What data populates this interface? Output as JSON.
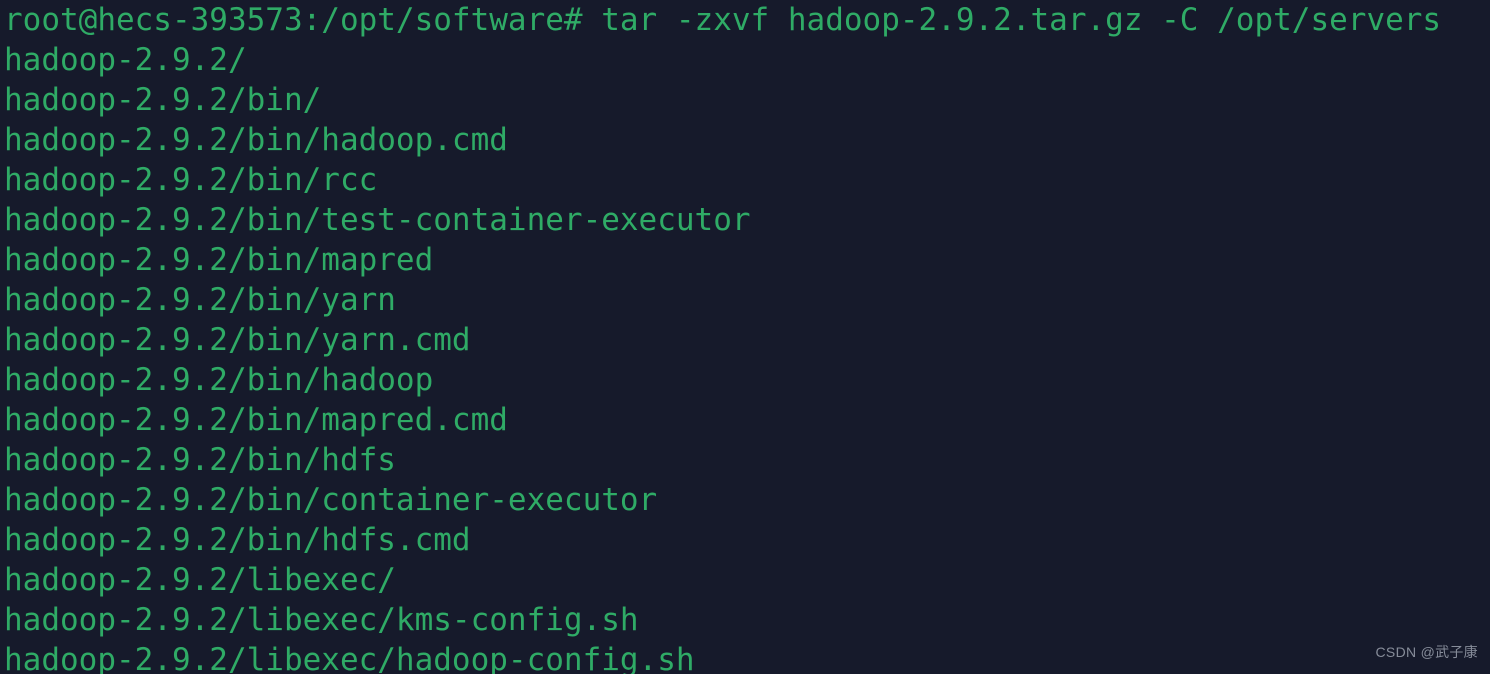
{
  "terminal": {
    "background_color": "#161a2b",
    "text_color": "#2fab66",
    "prompt": "root@hecs-393573:/opt/software#",
    "command": "tar -zxvf hadoop-2.9.2.tar.gz -C /opt/servers",
    "prompt_line": "root@hecs-393573:/opt/software# tar -zxvf hadoop-2.9.2.tar.gz -C /opt/servers",
    "output_lines": [
      "hadoop-2.9.2/",
      "hadoop-2.9.2/bin/",
      "hadoop-2.9.2/bin/hadoop.cmd",
      "hadoop-2.9.2/bin/rcc",
      "hadoop-2.9.2/bin/test-container-executor",
      "hadoop-2.9.2/bin/mapred",
      "hadoop-2.9.2/bin/yarn",
      "hadoop-2.9.2/bin/yarn.cmd",
      "hadoop-2.9.2/bin/hadoop",
      "hadoop-2.9.2/bin/mapred.cmd",
      "hadoop-2.9.2/bin/hdfs",
      "hadoop-2.9.2/bin/container-executor",
      "hadoop-2.9.2/bin/hdfs.cmd",
      "hadoop-2.9.2/libexec/",
      "hadoop-2.9.2/libexec/kms-config.sh",
      "hadoop-2.9.2/libexec/hadoop-config.sh"
    ]
  },
  "watermark": {
    "text": "CSDN @武子康",
    "color": "#9aa0ad"
  }
}
